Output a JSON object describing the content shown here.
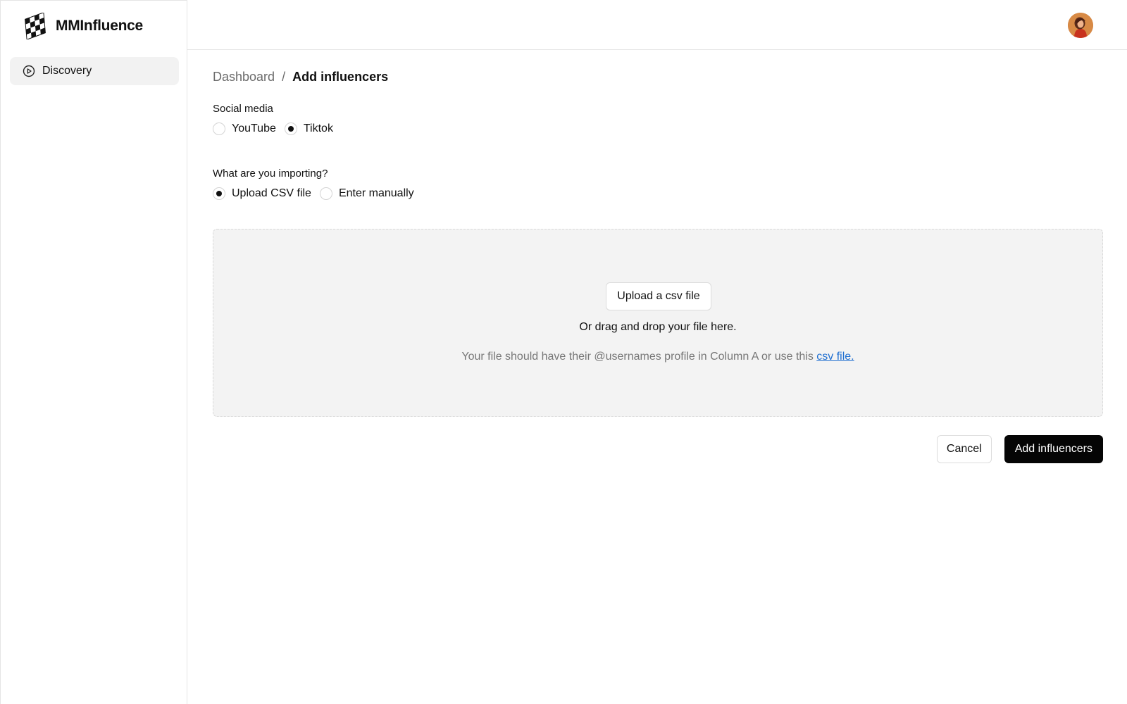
{
  "brand": {
    "name": "MMInfluence",
    "logo_icon": "checkered-logo-icon"
  },
  "sidebar": {
    "items": [
      {
        "label": "Discovery",
        "icon": "play-circle-icon",
        "active": true
      }
    ]
  },
  "header": {
    "avatar": "user-avatar"
  },
  "breadcrumb": {
    "parent": "Dashboard",
    "separator": "/",
    "current": "Add influencers"
  },
  "form": {
    "social_media": {
      "label": "Social media",
      "options": [
        {
          "label": "YouTube",
          "checked": false
        },
        {
          "label": "Tiktok",
          "checked": true
        }
      ]
    },
    "import_type": {
      "label": "What are you importing?",
      "options": [
        {
          "label": "Upload CSV file",
          "checked": true
        },
        {
          "label": "Enter manually",
          "checked": false
        }
      ]
    }
  },
  "dropzone": {
    "upload_button": "Upload a csv file",
    "drag_text": "Or drag and drop your file here.",
    "hint_text": "Your file should have their @usernames profile in Column A or use this ",
    "hint_link": "csv file."
  },
  "actions": {
    "cancel": "Cancel",
    "submit": "Add influencers"
  },
  "colors": {
    "primary": "#050505",
    "link": "#1f6fd1",
    "dropzone_bg": "#f3f3f3",
    "nav_active_bg": "#f2f2f2"
  }
}
